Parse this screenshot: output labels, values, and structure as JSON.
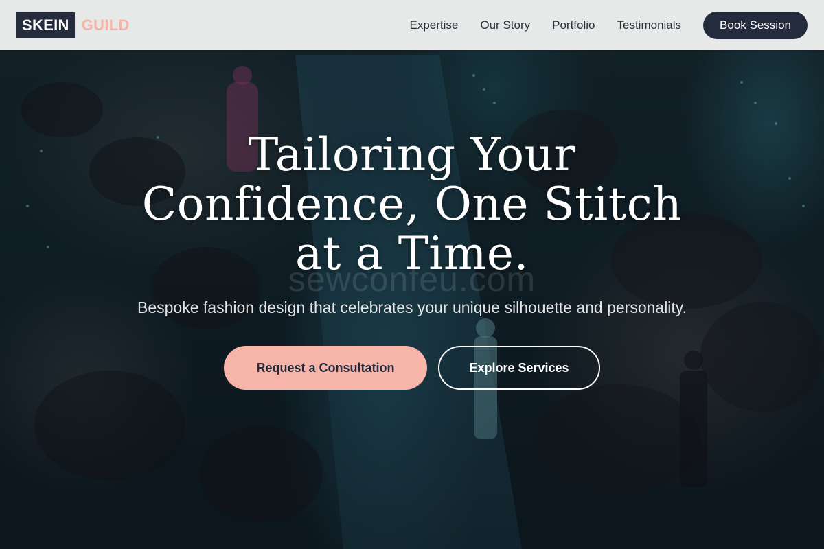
{
  "brand": {
    "logo_main": "SKEIN",
    "logo_accent": "GUILD",
    "colors": {
      "navy": "#232b3d",
      "accent": "#f7b5aa",
      "nav_bg": "#eeeeee"
    }
  },
  "nav": {
    "links": [
      "Expertise",
      "Our Story",
      "Portfolio",
      "Testimonials"
    ],
    "cta_label": "Book Session"
  },
  "hero": {
    "background_image": "fashion runway show with audience",
    "title": "Tailoring Your Confidence, One Stitch at a Time.",
    "subtitle": "Bespoke fashion design that celebrates your unique silhouette and personality.",
    "watermark": "sewconfeu.com",
    "primary_cta": "Request a Consultation",
    "secondary_cta": "Explore Services"
  }
}
